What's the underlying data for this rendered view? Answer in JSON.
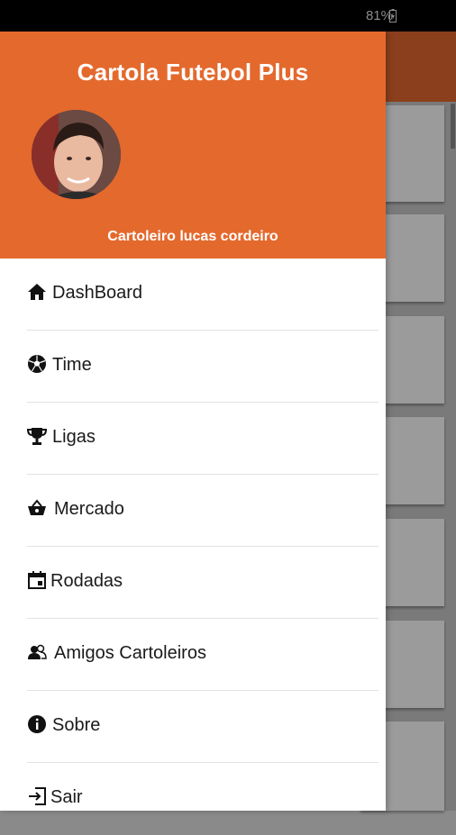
{
  "status_bar": {
    "battery_text": "81%",
    "battery_icon": "battery-charging-icon"
  },
  "drawer": {
    "app_title": "Cartola Futebol Plus",
    "user_name": "Cartoleiro lucas cordeiro",
    "header_color": "#e4692d",
    "items": [
      {
        "label": "DashBoard",
        "icon": "home-icon"
      },
      {
        "label": "Time",
        "icon": "soccer-ball-icon"
      },
      {
        "label": "Ligas",
        "icon": "trophy-icon"
      },
      {
        "label": "Mercado",
        "icon": "basket-icon"
      },
      {
        "label": "Rodadas",
        "icon": "calendar-icon"
      },
      {
        "label": "Amigos Cartoleiros",
        "icon": "friends-icon"
      },
      {
        "label": "Sobre",
        "icon": "info-icon"
      },
      {
        "label": "Sair",
        "icon": "logout-icon"
      }
    ]
  }
}
